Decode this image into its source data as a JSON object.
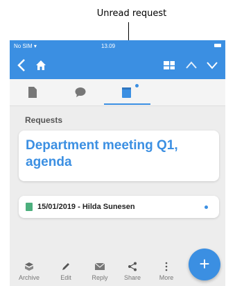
{
  "annotation": {
    "label": "Unread request"
  },
  "status_bar": {
    "carrier": "No SIM",
    "time": "13.09"
  },
  "nav": {
    "back_icon": "chevron-left-icon",
    "home_icon": "home-icon",
    "layout_icon": "layout-icon",
    "up_icon": "chevron-up-icon",
    "down_icon": "chevron-down-icon"
  },
  "tabs": [
    {
      "icon": "document-icon",
      "active": false
    },
    {
      "icon": "comment-icon",
      "active": false
    },
    {
      "icon": "request-icon",
      "active": true,
      "unread": true
    }
  ],
  "main": {
    "section_label": "Requests",
    "title": "Department meeting Q1, agenda",
    "items": [
      {
        "text": "15/01/2019 - Hilda Sunesen",
        "unread": true
      }
    ]
  },
  "toolbar": {
    "items": [
      {
        "label": "Archive",
        "icon": "archive-icon"
      },
      {
        "label": "Edit",
        "icon": "pencil-icon"
      },
      {
        "label": "Reply",
        "icon": "envelope-icon"
      },
      {
        "label": "Share",
        "icon": "share-icon"
      },
      {
        "label": "More",
        "icon": "more-icon"
      }
    ]
  },
  "fab": {
    "label": "+"
  },
  "colors": {
    "accent": "#3b8fe2",
    "background": "#ededed",
    "item_icon": "#4caf7d"
  }
}
